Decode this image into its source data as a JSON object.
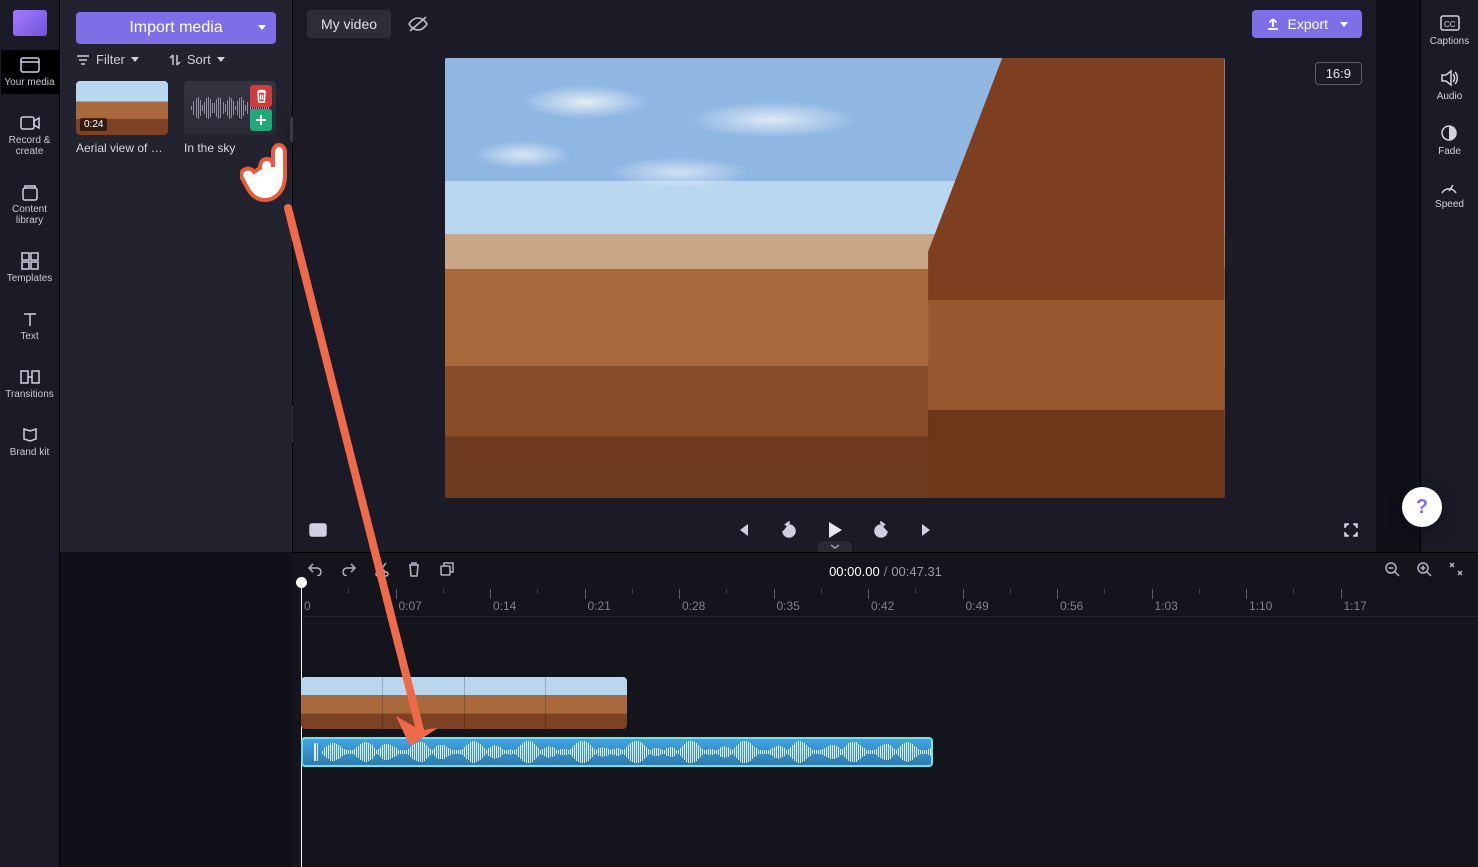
{
  "header": {
    "import": "Import media",
    "title": "My video",
    "export": "Export",
    "aspect": "16:9"
  },
  "leftRail": {
    "items": [
      {
        "key": "your-media",
        "label": "Your media"
      },
      {
        "key": "record",
        "label": "Record & create"
      },
      {
        "key": "content",
        "label": "Content library"
      },
      {
        "key": "templates",
        "label": "Templates"
      },
      {
        "key": "text",
        "label": "Text"
      },
      {
        "key": "transitions",
        "label": "Transitions"
      },
      {
        "key": "brand",
        "label": "Brand kit"
      }
    ]
  },
  "media": {
    "filter_label": "Filter",
    "sort_label": "Sort",
    "clips": [
      {
        "name": "Aerial view of …",
        "duration": "0:24",
        "type": "video",
        "in_timeline": true
      },
      {
        "name": "In the sky",
        "type": "audio"
      }
    ],
    "tooltip": "Add to timeline"
  },
  "rightRail": {
    "items": [
      {
        "key": "captions",
        "label": "Captions"
      },
      {
        "key": "audio",
        "label": "Audio"
      },
      {
        "key": "fade",
        "label": "Fade"
      },
      {
        "key": "speed",
        "label": "Speed"
      }
    ]
  },
  "time": {
    "current": "00:00.00",
    "total": "00:47.31"
  },
  "ruler_ticks": [
    "0",
    "0:07",
    "0:14",
    "0:21",
    "0:28",
    "0:35",
    "0:42",
    "0:49",
    "0:56",
    "1:03",
    "1:10",
    "1:17"
  ]
}
